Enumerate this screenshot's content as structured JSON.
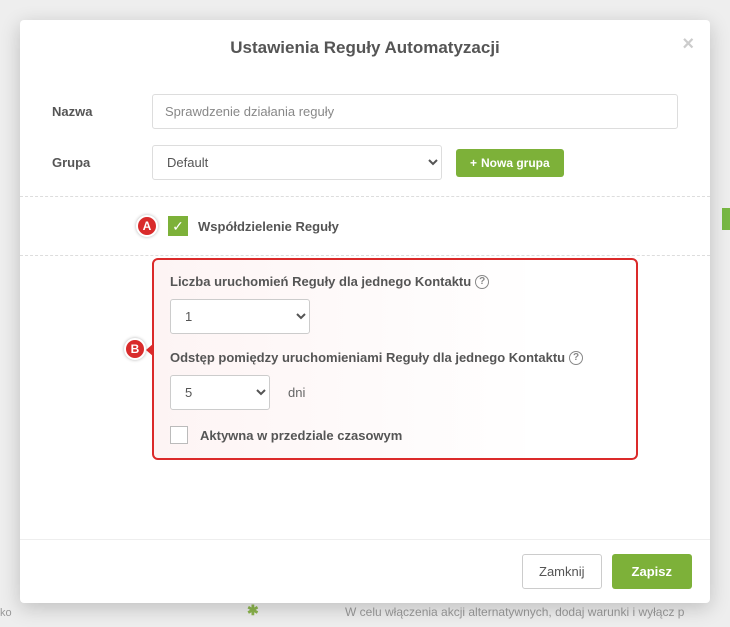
{
  "modal": {
    "title": "Ustawienia Reguły Automatyzacji"
  },
  "form": {
    "name_label": "Nazwa",
    "name_value": "Sprawdzenie działania reguły",
    "group_label": "Grupa",
    "group_value": "Default",
    "new_group_btn": "Nowa grupa"
  },
  "markers": {
    "a": "A",
    "b": "B"
  },
  "share": {
    "label": "Współdzielenie Reguły",
    "checked": true
  },
  "section_b": {
    "runs_label": "Liczba uruchomień Reguły dla jednego Kontaktu",
    "runs_value": "1",
    "interval_label": "Odstęp pomiędzy uruchomieniami Reguły dla jednego Kontaktu",
    "interval_value": "5",
    "interval_unit": "dni",
    "active_range_label": "Aktywna w przedziale czasowym"
  },
  "footer": {
    "close": "Zamknij",
    "save": "Zapisz"
  },
  "background": {
    "bottom_hint": "W celu włączenia akcji alternatywnych, dodaj warunki i wyłącz p",
    "left_frag": "ko",
    "x_glyph": "✱"
  }
}
